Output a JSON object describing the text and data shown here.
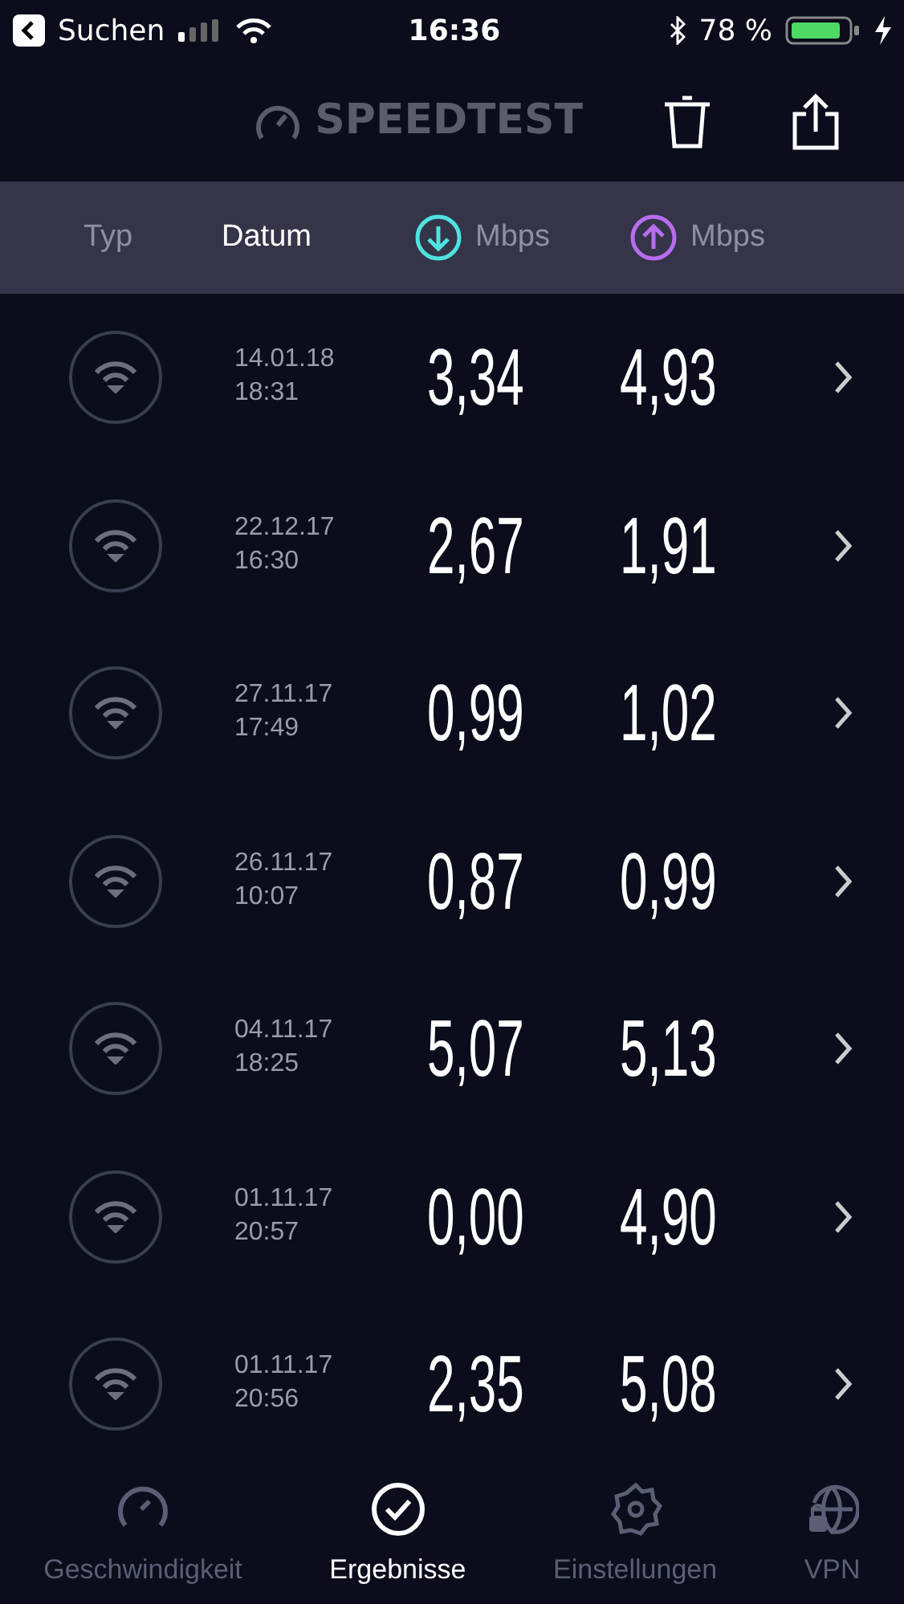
{
  "status_bar": {
    "back_label": "Suchen",
    "time": "16:36",
    "battery": "78 %"
  },
  "header": {
    "logo": "SPEEDTEST"
  },
  "columns": [
    {
      "label": "Typ",
      "selected": false,
      "kind": "text"
    },
    {
      "label": "Datum",
      "selected": true,
      "kind": "text"
    },
    {
      "label": "Mbps",
      "selected": false,
      "kind": "download"
    },
    {
      "label": "Mbps",
      "selected": false,
      "kind": "upload"
    }
  ],
  "results": [
    {
      "date": "14.01.18",
      "time": "18:31",
      "download": "3,34",
      "upload": "4,93"
    },
    {
      "date": "22.12.17",
      "time": "16:30",
      "download": "2,67",
      "upload": "1,91"
    },
    {
      "date": "27.11.17",
      "time": "17:49",
      "download": "0,99",
      "upload": "1,02"
    },
    {
      "date": "26.11.17",
      "time": "10:07",
      "download": "0,87",
      "upload": "0,99"
    },
    {
      "date": "04.11.17",
      "time": "18:25",
      "download": "5,07",
      "upload": "5,13"
    },
    {
      "date": "01.11.17",
      "time": "20:57",
      "download": "0,00",
      "upload": "4,90"
    },
    {
      "date": "01.11.17",
      "time": "20:56",
      "download": "2,35",
      "upload": "5,08"
    }
  ],
  "tab_bar": [
    {
      "label": "Geschwindigkeit",
      "selected": false,
      "kind": "gauge"
    },
    {
      "label": "Ergebnisse",
      "selected": true,
      "kind": "check"
    },
    {
      "label": "Einstellungen",
      "selected": false,
      "kind": "gear"
    },
    {
      "label": "VPN",
      "selected": false,
      "kind": "vpn"
    }
  ]
}
